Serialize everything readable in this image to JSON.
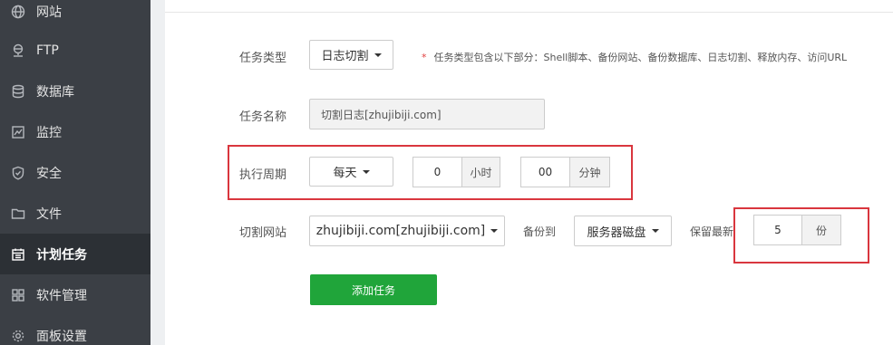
{
  "sidebar": {
    "items": [
      {
        "label": "网站",
        "icon": "globe-icon"
      },
      {
        "label": "FTP",
        "icon": "ftp-icon"
      },
      {
        "label": "数据库",
        "icon": "database-icon"
      },
      {
        "label": "监控",
        "icon": "monitor-icon"
      },
      {
        "label": "安全",
        "icon": "shield-icon"
      },
      {
        "label": "文件",
        "icon": "folder-icon"
      },
      {
        "label": "计划任务",
        "icon": "calendar-icon",
        "active": true
      },
      {
        "label": "软件管理",
        "icon": "grid-icon"
      },
      {
        "label": "面板设置",
        "icon": "gear-icon"
      }
    ]
  },
  "form": {
    "task_type": {
      "label": "任务类型",
      "value": "日志切割",
      "note_star": "*",
      "note": "任务类型包含以下部分：Shell脚本、备份网站、备份数据库、日志切割、释放内存、访问URL"
    },
    "task_name": {
      "label": "任务名称",
      "value": "切割日志[zhujibiji.com]"
    },
    "schedule": {
      "label": "执行周期",
      "period": "每天",
      "hour": "0",
      "hour_unit": "小时",
      "minute": "00",
      "minute_unit": "分钟"
    },
    "site": {
      "label": "切割网站",
      "value": "zhujibiji.com[zhujibiji.com]",
      "backup_to_label": "备份到",
      "backup_to": "服务器磁盘",
      "keep_label": "保留最新",
      "keep_count": "5",
      "keep_unit": "份"
    },
    "submit_label": "添加任务"
  },
  "colors": {
    "sidebar_bg": "#3b3f45",
    "sidebar_active_bg": "#2c3035",
    "accent_green": "#20a53a",
    "highlight_red": "#d9363e"
  }
}
